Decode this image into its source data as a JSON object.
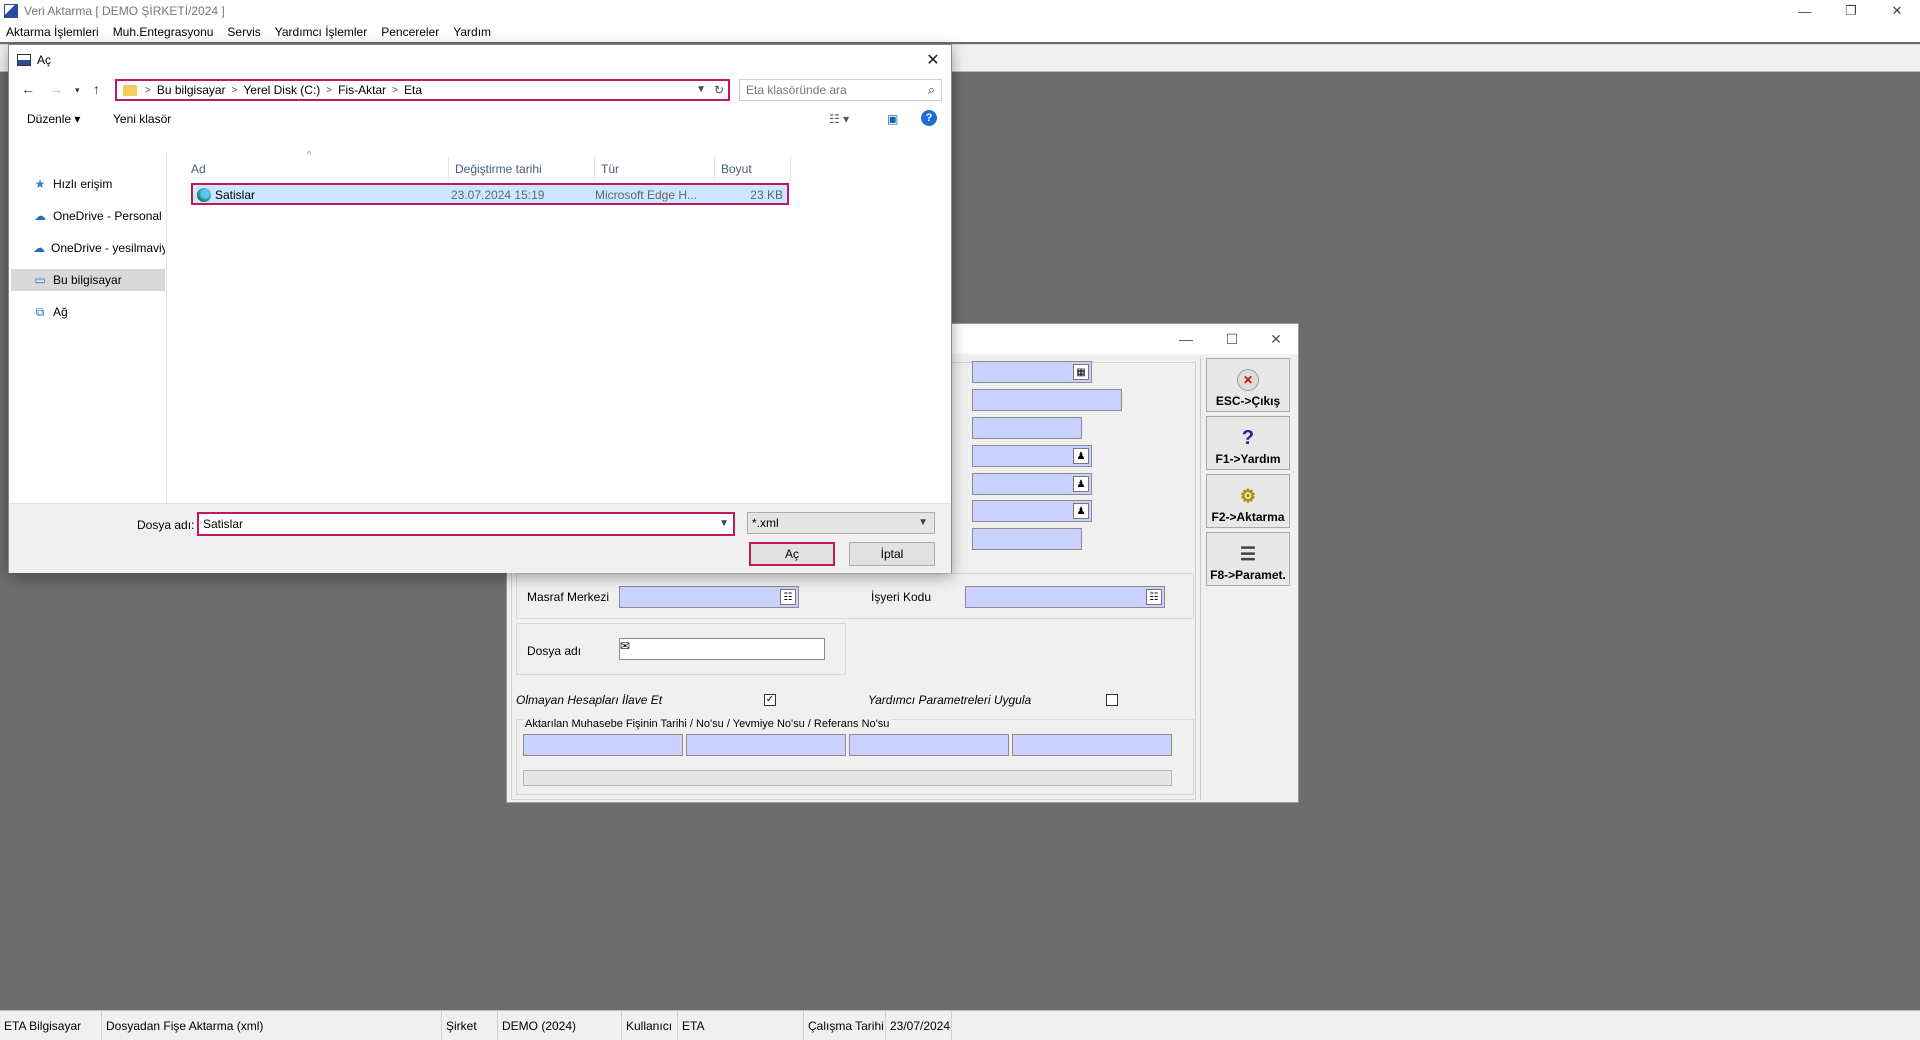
{
  "app": {
    "title": "Veri Aktarma [ DEMO ŞİRKETİ/2024 ]",
    "win_controls": [
      "—",
      "❐",
      "✕"
    ],
    "menu": [
      "Aktarma İşlemleri",
      "Muh.Entegrasyonu",
      "Servis",
      "Yardımcı İşlemler",
      "Pencereler",
      "Yardım"
    ]
  },
  "statusbar": {
    "cells": [
      "ETA Bilgisayar",
      "Dosyadan Fişe Aktarma (xml)",
      "Şirket",
      "DEMO (2024)",
      "Kullanıcı",
      "ETA",
      "Çalışma Tarihi",
      "23/07/2024"
    ]
  },
  "form": {
    "labels": {
      "masraf": "Masraf Merkezi",
      "isyeri": "İşyeri Kodu",
      "dosya": "Dosya adı",
      "olmayan": "Olmayan Hesapları İlave Et",
      "yardimci": "Yardımcı Parametreleri Uygula",
      "aktarilan": "Aktarılan Muhasebe Fişinin Tarihi / No'su / Yevmiye No'su / Referans No'su"
    },
    "olmayan_checked": true,
    "yardimci_checked": false,
    "buttons": [
      "ESC->Çıkış",
      "F1->Yardım",
      "F2->Aktarma",
      "F8->Paramet."
    ]
  },
  "dialog": {
    "title": "Aç",
    "address": [
      "Bu bilgisayar",
      "Yerel Disk (C:)",
      "Fis-Aktar",
      "Eta"
    ],
    "search_placeholder": "Eta klasöründe ara",
    "cmd": {
      "organize": "Düzenle ▾",
      "new_folder": "Yeni klasör"
    },
    "nav_items": [
      "Hızlı erişim",
      "OneDrive - Personal",
      "OneDrive - yesilmaviy",
      "Bu bilgisayar",
      "Ağ"
    ],
    "columns": [
      "Ad",
      "Değiştirme tarihi",
      "Tür",
      "Boyut"
    ],
    "file": {
      "name": "Satislar",
      "date": "23.07.2024 15:19",
      "type": "Microsoft Edge H...",
      "size": "23 KB"
    },
    "file_name_label": "Dosya adı:",
    "file_name_value": "Satislar",
    "file_type": "*.xml",
    "open": "Aç",
    "cancel": "İptal"
  }
}
